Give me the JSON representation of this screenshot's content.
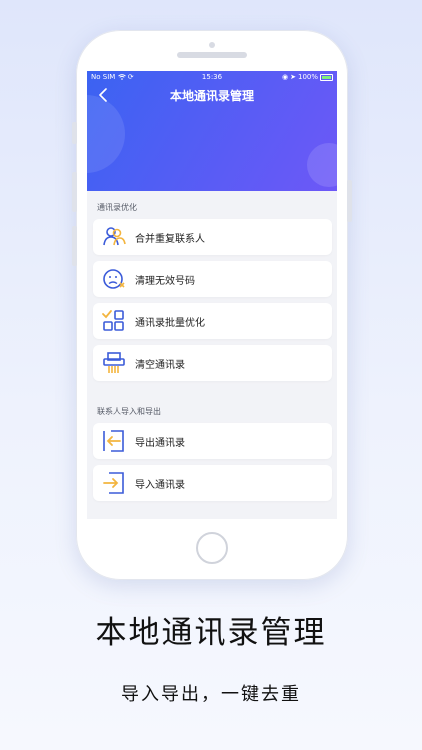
{
  "statusbar": {
    "carrier": "No SIM",
    "time": "15:36",
    "battery": "100%"
  },
  "header": {
    "title": "本地通讯录管理"
  },
  "sections": [
    {
      "label": "通讯录优化",
      "items": [
        {
          "label": "合并重复联系人",
          "icon": "merge-contacts-icon"
        },
        {
          "label": "清理无效号码",
          "icon": "sad-face-clean-icon"
        },
        {
          "label": "通讯录批量优化",
          "icon": "batch-grid-check-icon"
        },
        {
          "label": "清空通讯录",
          "icon": "shredder-icon"
        }
      ]
    },
    {
      "label": "联系人导入和导出",
      "items": [
        {
          "label": "导出通讯录",
          "icon": "export-arrow-icon"
        },
        {
          "label": "导入通讯录",
          "icon": "import-arrow-icon"
        }
      ]
    }
  ],
  "caption": {
    "title": "本地通讯录管理",
    "subtitle": "导入导出，一键去重"
  },
  "colors": {
    "header_gradient_start": "#3b63f2",
    "header_gradient_end": "#6d58f7",
    "icon_blue": "#3b5bd9",
    "icon_yellow": "#f3b53f"
  }
}
